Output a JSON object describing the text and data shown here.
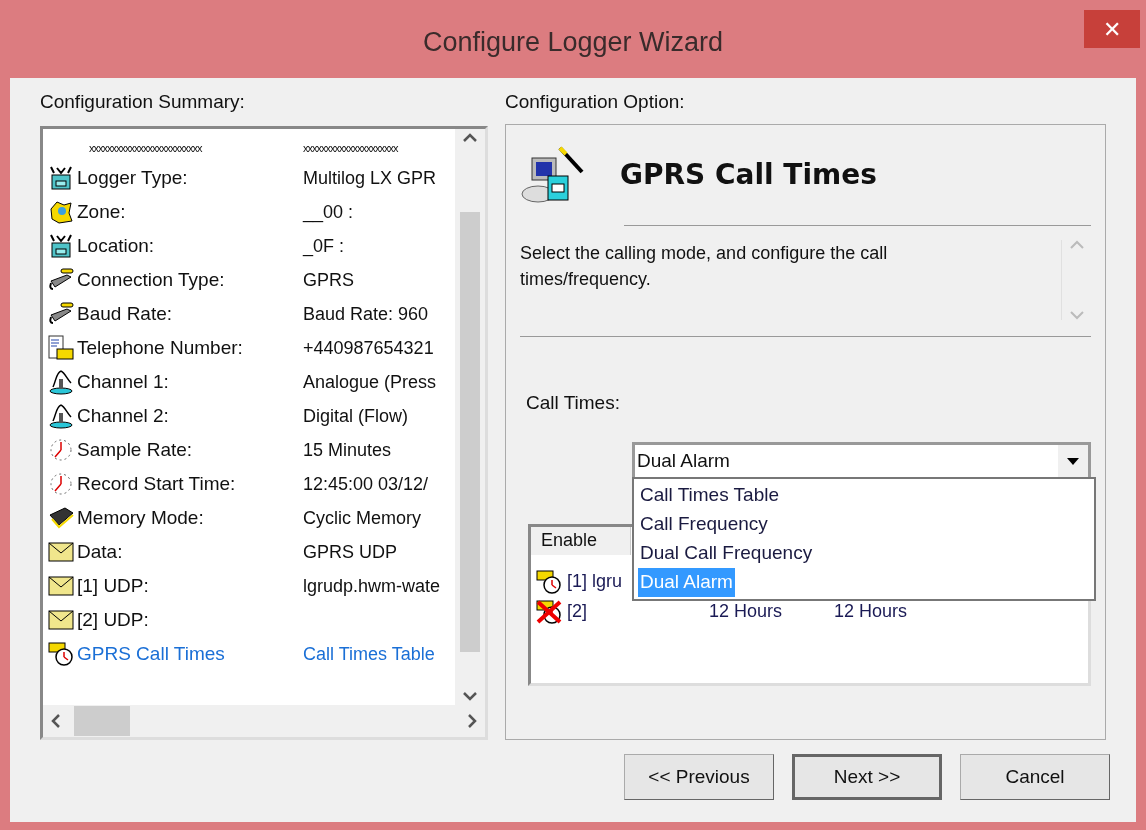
{
  "window": {
    "title": "Configure Logger Wizard",
    "close": "✕"
  },
  "summary": {
    "label": "Configuration Summary:",
    "header": [
      "xxxxxxxxxxxxxxxxxxxxxxxxx",
      "xxxxxxxxxxxxxxxxxxxxx"
    ],
    "rows": [
      {
        "kind": "logger",
        "label": "Logger Type:",
        "value": "Multilog LX GPR",
        "current": false
      },
      {
        "kind": "zone",
        "label": "Zone:",
        "value": "__00 :",
        "current": false
      },
      {
        "kind": "logger",
        "label": "Location:",
        "value": "_0F :",
        "current": false
      },
      {
        "kind": "connection",
        "label": "Connection Type:",
        "value": "GPRS",
        "current": false
      },
      {
        "kind": "connection",
        "label": "Baud Rate:",
        "value": "Baud Rate: 960",
        "current": false
      },
      {
        "kind": "phone",
        "label": "Telephone Number:",
        "value": "+440987654321",
        "current": false
      },
      {
        "kind": "channel",
        "label": "Channel 1:",
        "value": "Analogue (Press",
        "current": false
      },
      {
        "kind": "channel",
        "label": "Channel 2:",
        "value": "Digital (Flow)",
        "current": false
      },
      {
        "kind": "clock",
        "label": "Sample Rate:",
        "value": "15 Minutes",
        "current": false
      },
      {
        "kind": "clock",
        "label": "Record Start Time:",
        "value": "12:45:00 03/12/",
        "current": false
      },
      {
        "kind": "memory",
        "label": "Memory Mode:",
        "value": "Cyclic Memory",
        "current": false
      },
      {
        "kind": "mail",
        "label": "Data:",
        "value": "GPRS UDP",
        "current": false
      },
      {
        "kind": "mail",
        "label": "[1] UDP:",
        "value": "lgrudp.hwm-wate",
        "current": false
      },
      {
        "kind": "mail",
        "label": "[2] UDP:",
        "value": "",
        "current": false
      },
      {
        "kind": "calltime",
        "label": "GPRS Call Times",
        "value": "Call Times Table",
        "current": true
      }
    ]
  },
  "option": {
    "label": "Configuration Option:",
    "title": "GPRS Call Times",
    "description": "Select the calling mode, and configure the call times/frequency.",
    "call_times_label": "Call Times:",
    "dropdown": {
      "value": "Dual Alarm",
      "items": [
        {
          "label": "Call Times Table",
          "selected": false
        },
        {
          "label": "Call Frequency",
          "selected": false
        },
        {
          "label": "Dual Call Frequency",
          "selected": false
        },
        {
          "label": "Dual Alarm",
          "selected": true
        }
      ]
    },
    "table": {
      "columns": [
        "Enable"
      ],
      "rows": [
        {
          "enabled": true,
          "label": "[1] lgru",
          "column_2": "",
          "column_3": ""
        },
        {
          "enabled": false,
          "label": "[2]",
          "column_2": "12 Hours",
          "column_3": "12 Hours"
        }
      ]
    }
  },
  "buttons": [
    {
      "label": "<< Previous",
      "default": false
    },
    {
      "label": "Next >>",
      "default": true
    },
    {
      "label": "Cancel",
      "default": false
    }
  ]
}
